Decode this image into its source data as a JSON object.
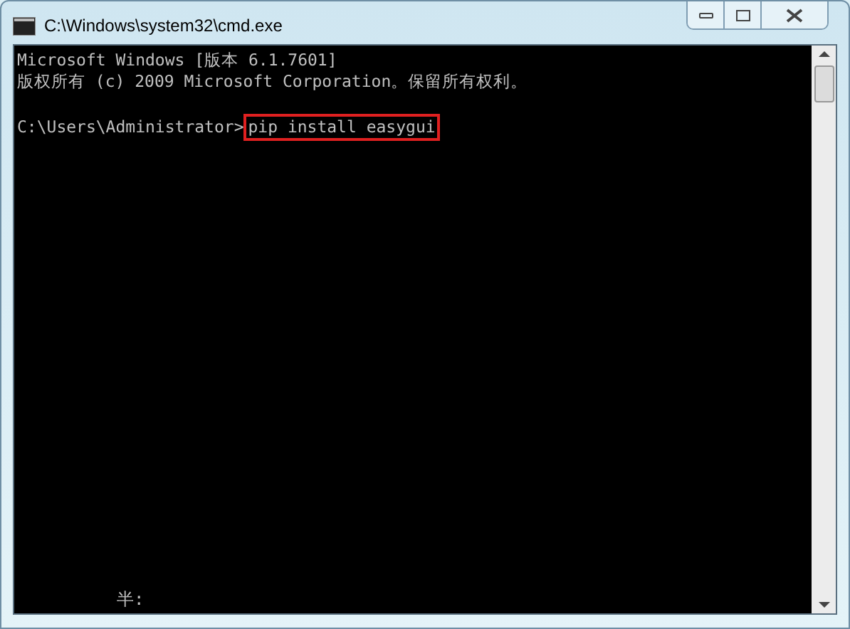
{
  "window": {
    "title": "C:\\Windows\\system32\\cmd.exe"
  },
  "console": {
    "lines": [
      "Microsoft Windows [版本 6.1.7601]",
      "版权所有 (c) 2009 Microsoft Corporation。保留所有权利。"
    ],
    "prompt": "C:\\Users\\Administrator>",
    "command": {
      "text": "pip install easygui",
      "highlighted": true
    }
  },
  "ime_status": "半:"
}
